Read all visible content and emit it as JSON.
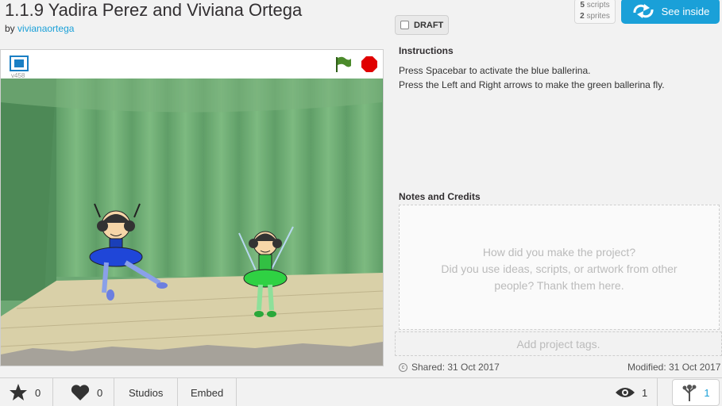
{
  "project": {
    "title": "1.1.9 Yadira Perez and Viviana Ortega",
    "by_prefix": "by",
    "author": "vivianaortega",
    "draft_label": "DRAFT",
    "scripts_count": "5",
    "scripts_label": "scripts",
    "sprites_count": "2",
    "sprites_label": "sprites",
    "see_inside_label": "See inside"
  },
  "player": {
    "version": "v458",
    "icons": [
      "fullscreen-icon",
      "green-flag-icon",
      "stop-icon"
    ]
  },
  "instructions": {
    "heading": "Instructions",
    "line1": "Press Spacebar to activate the blue ballerina.",
    "line2": "Press the Left and Right arrows to make the green ballerina fly."
  },
  "notes": {
    "heading": "Notes and Credits",
    "placeholder_line1": "How did you make the project?",
    "placeholder_line2": "Did you use ideas, scripts, or artwork from other",
    "placeholder_line3": "people? Thank them here."
  },
  "tags": {
    "placeholder": "Add project tags."
  },
  "meta": {
    "shared": "Shared: 31 Oct 2017",
    "modified": "Modified: 31 Oct 2017"
  },
  "footer": {
    "favorites": "0",
    "loves": "0",
    "studios": "Studios",
    "embed": "Embed",
    "views": "1",
    "remixes": "1"
  },
  "colors": {
    "accent": "#1aa0d8",
    "flag": "#4b8a2b",
    "stop": "#e00000"
  }
}
